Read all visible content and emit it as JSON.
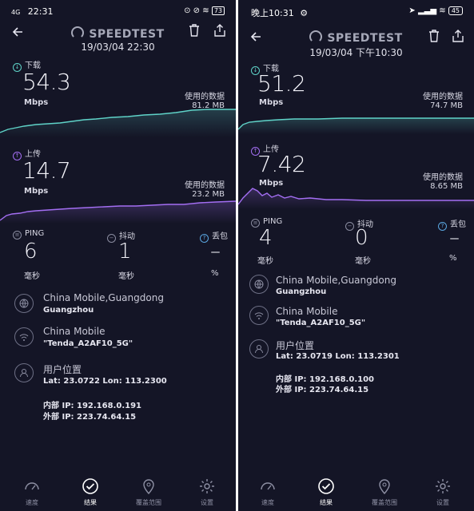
{
  "colors": {
    "background": "#141526",
    "download": "#5fd3c8",
    "upload": "#a36ef2",
    "muted": "#8a8ca0"
  },
  "screens": [
    {
      "status": {
        "time": "22:31",
        "left_icons": "4G",
        "battery": "73"
      },
      "brand": "SPEEDTEST",
      "date": "19/03/04 22:30",
      "download": {
        "label": "下载",
        "value": "54.3",
        "unit": "Mbps",
        "used_label": "使用的数据",
        "used_value": "81.2 MB"
      },
      "upload": {
        "label": "上传",
        "value": "14.7",
        "unit": "Mbps",
        "used_label": "使用的数据",
        "used_value": "23.2 MB"
      },
      "ping": {
        "label": "PING",
        "value": "6",
        "unit": "毫秒"
      },
      "jitter": {
        "label": "抖动",
        "value": "1",
        "unit": "毫秒"
      },
      "loss": {
        "label": "丢包",
        "value": "–",
        "unit": "%"
      },
      "server": {
        "line1": "China Mobile,Guangdong",
        "line2": "Guangzhou"
      },
      "network": {
        "line1": "China Mobile",
        "line2": "\"Tenda_A2AF10_5G\""
      },
      "location": {
        "line1": "用户位置",
        "line2": "Lat: 23.0722 Lon: 113.2300"
      },
      "internal_ip": "内部 IP: 192.168.0.191",
      "external_ip": "外部 IP: 223.74.64.15",
      "nav": [
        "速度",
        "结果",
        "覆盖范围",
        "设置"
      ]
    },
    {
      "status": {
        "time": "晚上10:31",
        "left_icons": "",
        "battery": "45"
      },
      "brand": "SPEEDTEST",
      "date": "19/03/04 下午10:30",
      "download": {
        "label": "下载",
        "value": "51.2",
        "unit": "Mbps",
        "used_label": "使用的数据",
        "used_value": "74.7 MB"
      },
      "upload": {
        "label": "上传",
        "value": "7.42",
        "unit": "Mbps",
        "used_label": "使用的数据",
        "used_value": "8.65 MB"
      },
      "ping": {
        "label": "PING",
        "value": "4",
        "unit": "毫秒"
      },
      "jitter": {
        "label": "抖动",
        "value": "0",
        "unit": "毫秒"
      },
      "loss": {
        "label": "丢包",
        "value": "–",
        "unit": "%"
      },
      "server": {
        "line1": "China Mobile,Guangdong",
        "line2": "Guangzhou"
      },
      "network": {
        "line1": "China Mobile",
        "line2": "\"Tenda_A2AF10_5G\""
      },
      "location": {
        "line1": "用户位置",
        "line2": "Lat: 23.0719 Lon: 113.2301"
      },
      "internal_ip": "内部 IP: 192.168.0.100",
      "external_ip": "外部 IP: 223.74.64.15",
      "nav": [
        "速度",
        "结果",
        "覆盖范围",
        "设置"
      ]
    }
  ]
}
